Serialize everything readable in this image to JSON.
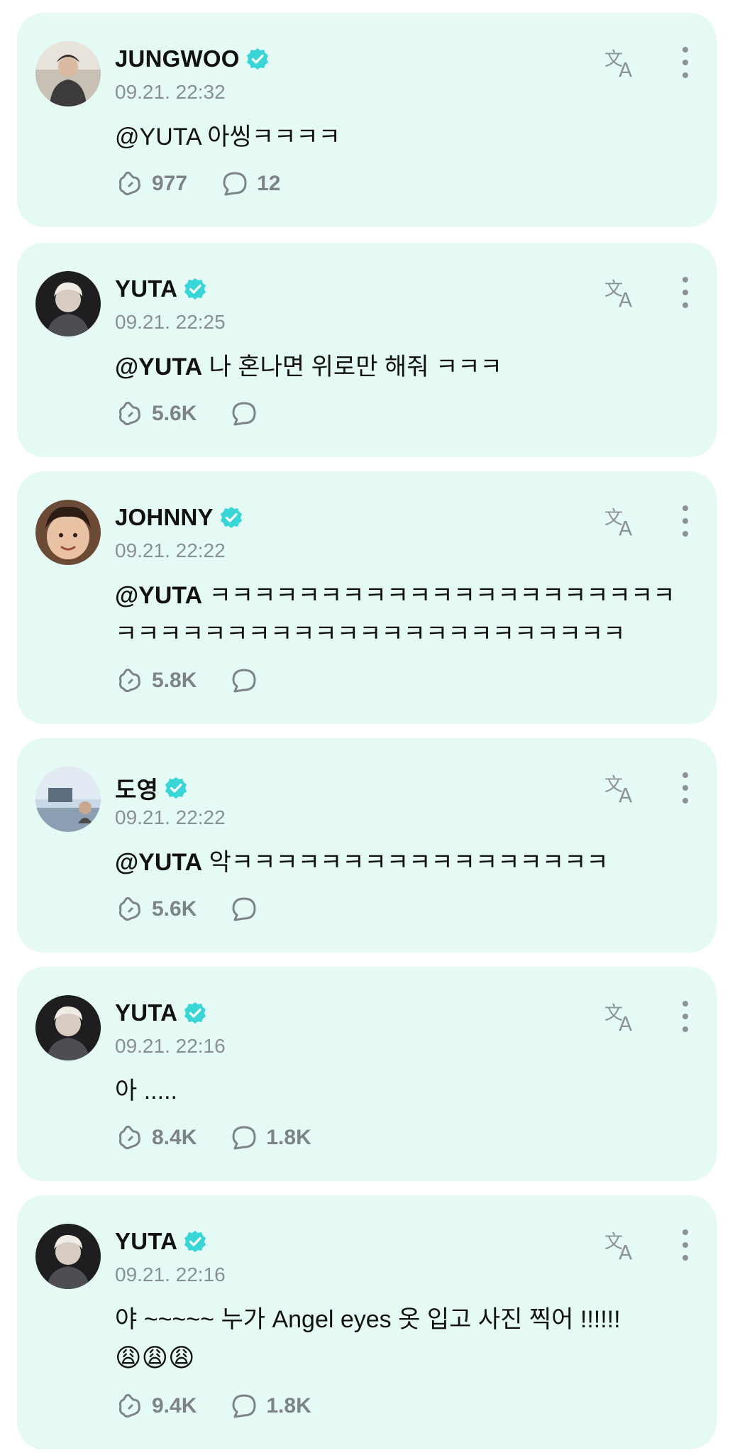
{
  "accent_color": "#38d6d6",
  "card_background": "#e6faf5",
  "posts": [
    {
      "author": "JUNGWOO",
      "verified": true,
      "time": "09.21. 22:32",
      "mention": "",
      "text": "@YUTA 아씽ㅋㅋㅋㅋ",
      "likes": "977",
      "comments": "12",
      "avatar_icon": "avatar-jungwoo"
    },
    {
      "author": "YUTA",
      "verified": true,
      "time": "09.21. 22:25",
      "mention": "@YUTA",
      "text": " 나 혼나면 위로만 해줘 ㅋㅋㅋ",
      "likes": "5.6K",
      "comments": "",
      "avatar_icon": "avatar-yuta"
    },
    {
      "author": "JOHNNY",
      "verified": true,
      "time": "09.21. 22:22",
      "mention": "@YUTA",
      "text": " ㅋㅋㅋㅋㅋㅋㅋㅋㅋㅋㅋㅋㅋㅋㅋㅋㅋㅋㅋㅋㅋㅋㅋㅋㅋㅋㅋㅋㅋㅋㅋㅋㅋㅋㅋㅋㅋㅋㅋㅋㅋㅋㅋㅋ",
      "likes": "5.8K",
      "comments": "",
      "avatar_icon": "avatar-johnny"
    },
    {
      "author": "도영",
      "verified": true,
      "time": "09.21. 22:22",
      "mention": "@YUTA",
      "text": " 악ㅋㅋㅋㅋㅋㅋㅋㅋㅋㅋㅋㅋㅋㅋㅋㅋㅋ",
      "likes": "5.6K",
      "comments": "",
      "avatar_icon": "avatar-doyoung"
    },
    {
      "author": "YUTA",
      "verified": true,
      "time": "09.21. 22:16",
      "mention": "",
      "text": "아 .....",
      "likes": "8.4K",
      "comments": "1.8K",
      "avatar_icon": "avatar-yuta"
    },
    {
      "author": "YUTA",
      "verified": true,
      "time": "09.21. 22:16",
      "mention": "",
      "text": "야 ~~~~~ 누가 Angel eyes 옷 입고 사진 찍어 !!!!!!",
      "emoji": "😩😩😩",
      "likes": "9.4K",
      "comments": "1.8K",
      "avatar_icon": "avatar-yuta"
    }
  ]
}
